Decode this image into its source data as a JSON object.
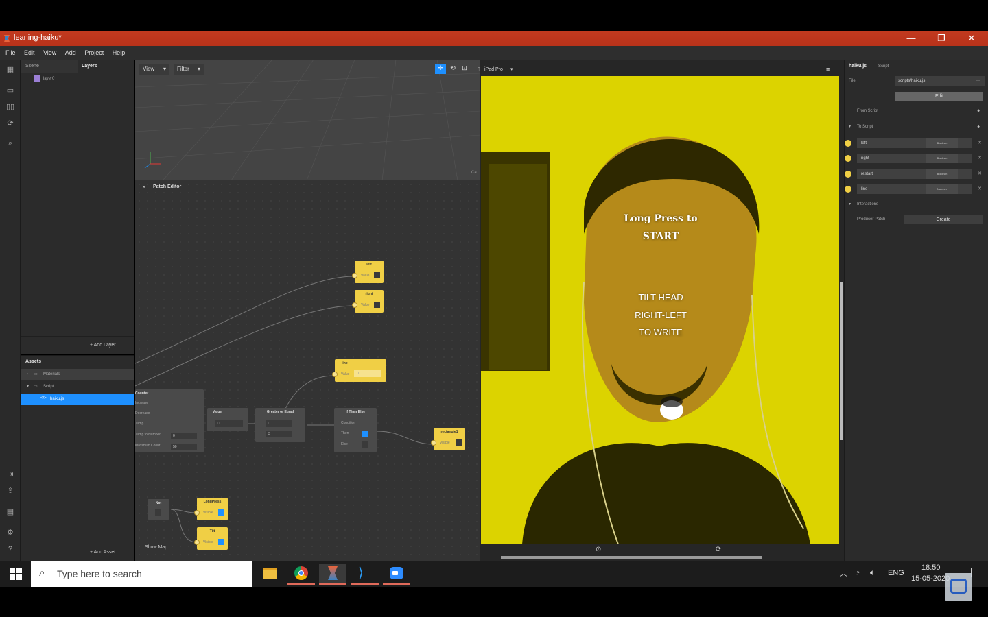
{
  "app": {
    "title": "leaning-haiku*",
    "menu": [
      "File",
      "Edit",
      "View",
      "Add",
      "Project",
      "Help"
    ]
  },
  "scene_panel": {
    "tabs": [
      "Scene",
      "Layers"
    ],
    "layer": "layer0",
    "add_layer": "+ Add Layer"
  },
  "assets_panel": {
    "title": "Assets",
    "items": [
      "Materials",
      "Script",
      "haiku.js"
    ],
    "add_asset": "+ Add Asset"
  },
  "viewport": {
    "view_label": "View",
    "filter_label": "Filter",
    "device": "iPad Pro",
    "cam_label": "Ca"
  },
  "patch_editor": {
    "title": "Patch Editor",
    "nodes": {
      "left": {
        "title": "left",
        "port": "Value"
      },
      "right": {
        "title": "right",
        "port": "Value"
      },
      "line": {
        "title": "line",
        "port": "Value",
        "value": "0"
      },
      "counter": {
        "title": "Counter",
        "rows": [
          "Increase",
          "Decrease",
          "Jump",
          "Jump to Number",
          "Maximum Count"
        ],
        "jump_to": "0",
        "max_count": "50"
      },
      "value": {
        "title": "Value",
        "value": "0"
      },
      "gte": {
        "title": "Greater or Equal",
        "a": "0",
        "b": "3"
      },
      "ifthen": {
        "title": "If Then Else",
        "rows": [
          "Condition",
          "Then",
          "Else"
        ]
      },
      "rect": {
        "title": "rectangle1",
        "port": "Visible"
      },
      "not": {
        "title": "Not"
      },
      "longpress": {
        "title": "LongPress",
        "port": "Visible"
      },
      "tilt": {
        "title": "Tilt",
        "port": "Visible"
      }
    },
    "show_map": "Show Map"
  },
  "preview": {
    "line1": "Long Press to",
    "line2": "START",
    "line3": "TILT HEAD",
    "line4": "RIGHT-LEFT",
    "line5": "TO WRITE"
  },
  "inspector": {
    "filename": "haiku.js",
    "kind": "– Script",
    "file_label": "File",
    "file_value": "scripts/haiku.js",
    "edit_button": "Edit",
    "from_script": "From Script",
    "to_script": "To Script",
    "vars": [
      {
        "name": "left",
        "type": "Boolean"
      },
      {
        "name": "right",
        "type": "Boolean"
      },
      {
        "name": "restart",
        "type": "Boolean"
      },
      {
        "name": "line",
        "type": "Number"
      }
    ],
    "interactions": "Interactions",
    "producer_patch": "Producer Patch",
    "create_button": "Create"
  },
  "taskbar": {
    "search_placeholder": "Type here to search",
    "lang": "ENG",
    "time": "18:50",
    "date": "15-05-2020"
  },
  "colors": {
    "titlebar": "#b8321a",
    "node_yellow": "#f0cf45",
    "selection": "#1e90ff",
    "camera_tint": "#d9d400"
  }
}
